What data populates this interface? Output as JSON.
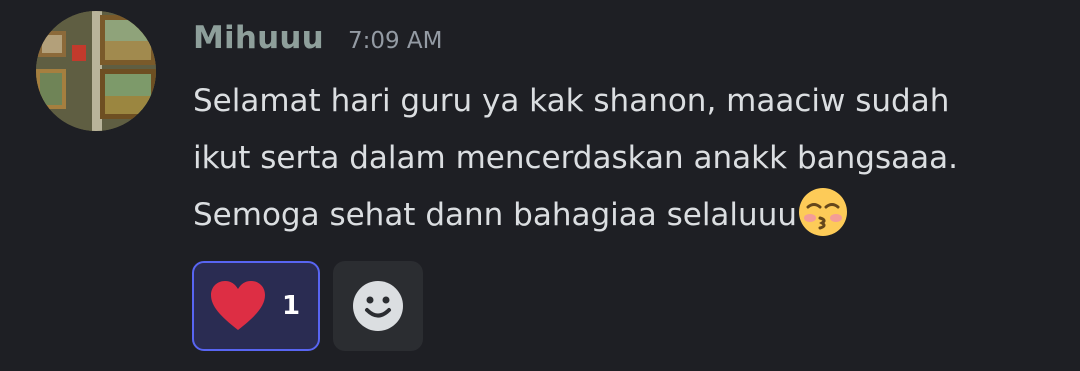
{
  "message": {
    "author": "Mihuuu",
    "timestamp": "7:09 AM",
    "lines": [
      "Selamat hari guru ya kak shanon, maaciw sudah",
      "ikut serta dalam mencerdaskan anakk bangsaaa.",
      "Semoga sehat dann bahagiaa selaluuu"
    ],
    "trailing_emoji": "kissing-face-with-closed-eyes"
  },
  "reactions": [
    {
      "icon": "heart-icon",
      "count": "1",
      "active": true,
      "accent": "#5865f2"
    }
  ],
  "add_reaction": {
    "icon": "smiley-add-reaction-icon"
  },
  "colors": {
    "background": "#1e1f24",
    "username": "#8e9f9b",
    "timestamp": "#949ba4",
    "text": "#dbdee1",
    "reaction_bg": "#2a2c52",
    "reaction_border": "#5865f2",
    "heart": "#dd2e44"
  }
}
